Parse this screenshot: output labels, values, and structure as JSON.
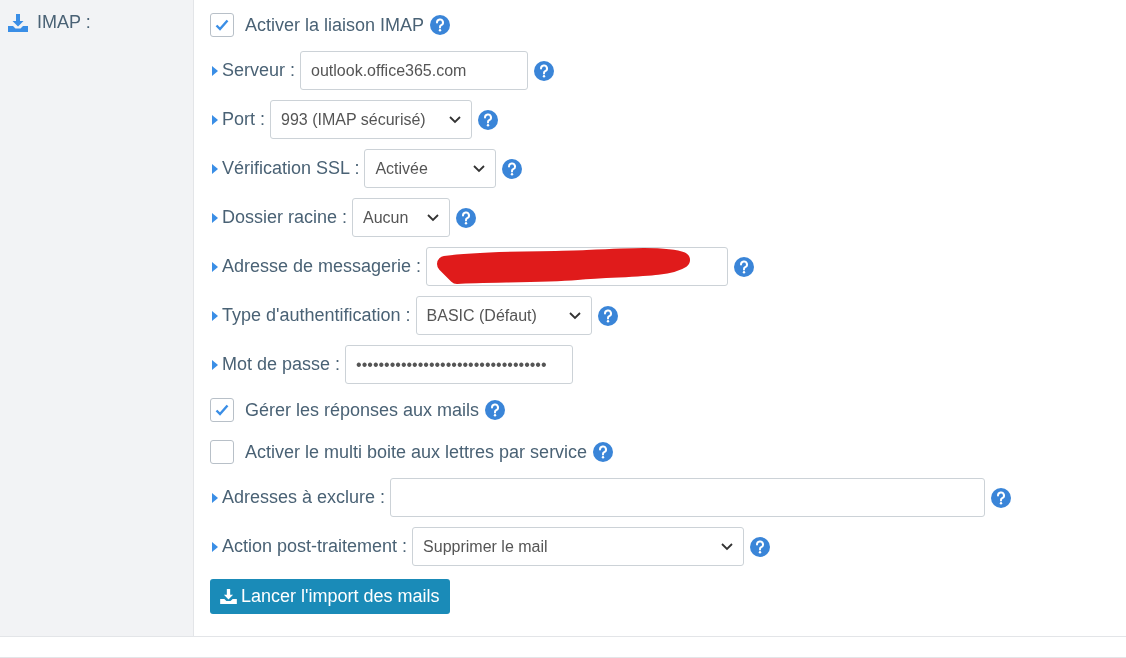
{
  "section": {
    "label": "IMAP :"
  },
  "rows": [
    {
      "kind": "checkbox",
      "label": "Activer la liaison IMAP",
      "checked": true,
      "help": true
    },
    {
      "kind": "input",
      "label": "Serveur :",
      "value": "outlook.office365.com",
      "help": true
    },
    {
      "kind": "select",
      "label": "Port :",
      "value": "993 (IMAP sécurisé)",
      "help": true
    },
    {
      "kind": "select",
      "label": "Vérification SSL :",
      "value": "Activée",
      "help": true
    },
    {
      "kind": "select",
      "label": "Dossier racine :",
      "value": "Aucun",
      "help": true
    },
    {
      "kind": "input",
      "label": "Adresse de messagerie :",
      "redacted": true,
      "help": true
    },
    {
      "kind": "select",
      "label": "Type d'authentification :",
      "value": "BASIC (Défaut)",
      "help": true
    },
    {
      "kind": "input",
      "label": "Mot de passe :",
      "value": "••••••••••••••••••••••••••••••••••",
      "help": false
    },
    {
      "kind": "checkbox",
      "label": "Gérer les réponses aux mails",
      "checked": true,
      "help": true
    },
    {
      "kind": "checkbox",
      "label": "Activer le multi boite aux lettres par service",
      "checked": false,
      "help": true
    },
    {
      "kind": "input",
      "label": "Adresses à exclure :",
      "help": true
    },
    {
      "kind": "select",
      "label": "Action post-traitement :",
      "value": "Supprimer le mail",
      "help": true
    }
  ],
  "button": {
    "label": "Lancer l'import des mails"
  }
}
